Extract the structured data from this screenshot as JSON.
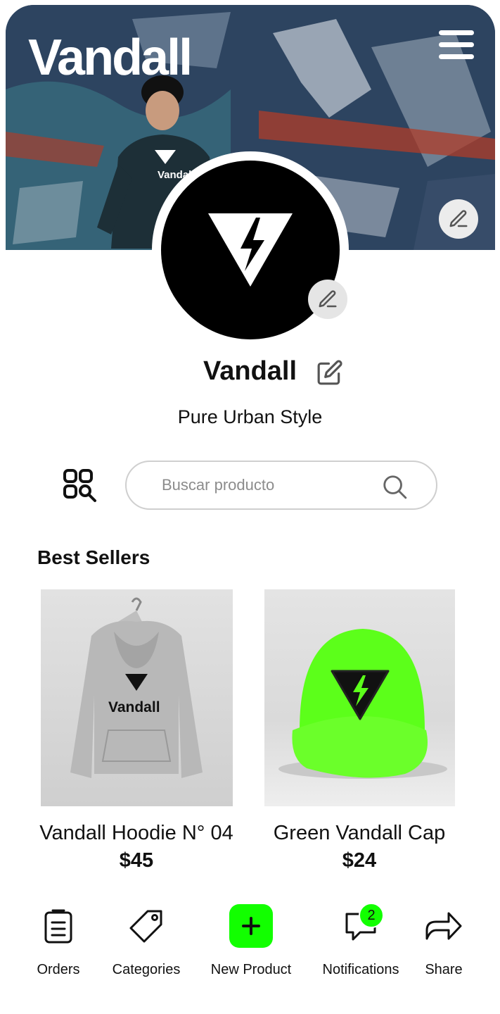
{
  "header": {
    "brand": "Vandall",
    "menu_icon": "hamburger-menu-icon",
    "edit_icon": "pencil-icon"
  },
  "profile": {
    "name": "Vandall",
    "tagline": "Pure Urban Style",
    "avatar_icon": "lightning-triangle-logo-icon",
    "shirt_logo_text": "Vandall"
  },
  "search": {
    "placeholder": "Buscar producto",
    "value": "",
    "filter_icon": "grid-search-icon",
    "search_icon": "search-icon"
  },
  "best_sellers": {
    "title": "Best Sellers",
    "products": [
      {
        "name": "Vandall Hoodie N° 04",
        "price": "$45",
        "image_logo": "Vandall"
      },
      {
        "name": "Green Vandall Cap",
        "price": "$24"
      }
    ]
  },
  "nav": {
    "items": [
      {
        "label": "Orders",
        "icon": "clipboard-icon"
      },
      {
        "label": "Categories",
        "icon": "tag-icon"
      },
      {
        "label": "New Product",
        "icon": "plus-icon"
      },
      {
        "label": "Notifications",
        "icon": "chat-bubble-icon",
        "badge": "2"
      },
      {
        "label": "Share",
        "icon": "share-arrow-icon"
      }
    ]
  },
  "colors": {
    "accent": "#12ff00",
    "text": "#111111",
    "avatar_bg": "#000000"
  }
}
